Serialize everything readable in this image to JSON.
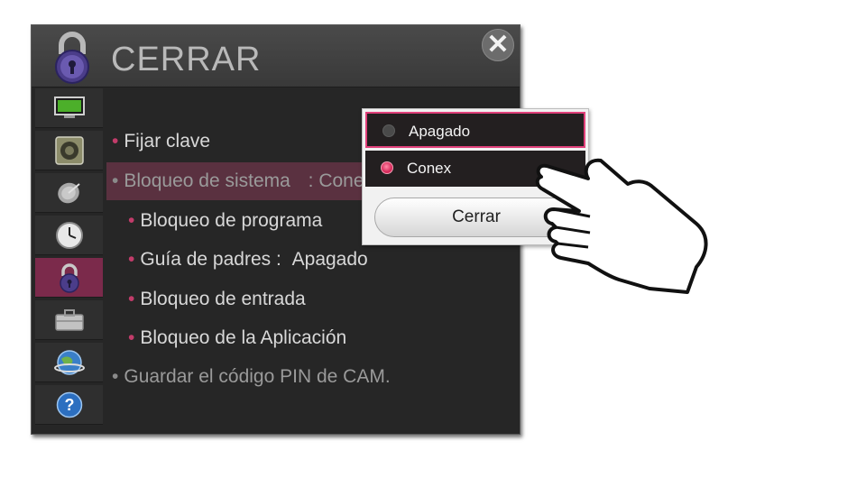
{
  "header": {
    "title": "CERRAR",
    "icon": "lock-icon",
    "close_icon": "close-icon"
  },
  "sidebar": {
    "items": [
      {
        "icon": "tv-picture-icon"
      },
      {
        "icon": "speaker-icon"
      },
      {
        "icon": "satellite-icon"
      },
      {
        "icon": "clock-icon"
      },
      {
        "icon": "lock-icon",
        "active": true
      },
      {
        "icon": "toolbox-icon"
      },
      {
        "icon": "network-globe-icon"
      },
      {
        "icon": "help-icon"
      }
    ]
  },
  "menu": {
    "fijar_clave": "Fijar clave",
    "bloqueo_sistema": "Bloqueo de sistema",
    "bloqueo_sistema_value": ":  Conex",
    "bloqueo_programa": "Bloqueo de programa",
    "guia_padres": "Guía de padres :",
    "guia_padres_value": "Apagado",
    "bloqueo_entrada": "Bloqueo de entrada",
    "bloqueo_aplicacion": "Bloqueo de la Aplicación",
    "guardar_pin": "Guardar el código PIN de CAM."
  },
  "popup": {
    "options": [
      {
        "label": "Apagado",
        "selected": false
      },
      {
        "label": "Conex",
        "selected": true
      }
    ],
    "close_label": "Cerrar"
  },
  "colors": {
    "accent": "#c23c6a",
    "active_sidebar": "#7b2a4b",
    "highlight_row": "#5a3140"
  }
}
